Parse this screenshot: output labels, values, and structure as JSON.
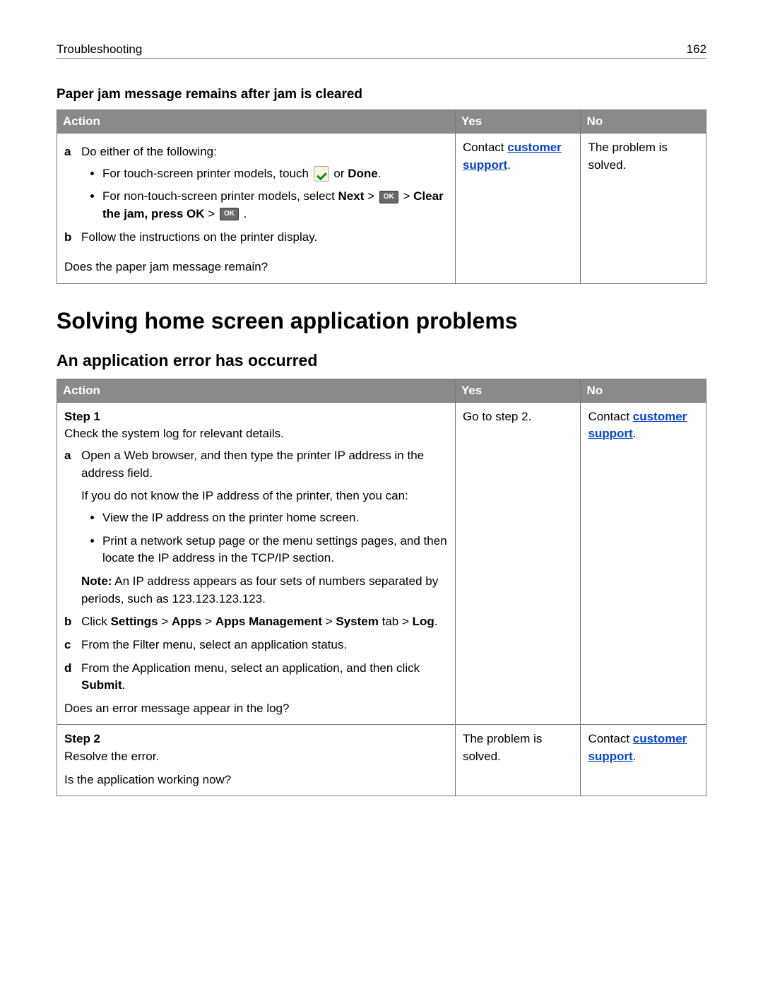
{
  "header": {
    "section": "Troubleshooting",
    "page": "162"
  },
  "section1": {
    "title": "Paper jam message remains after jam is cleared",
    "table": {
      "columns": {
        "action": "Action",
        "yes": "Yes",
        "no": "No"
      },
      "row": {
        "a_intro": "Do either of the following:",
        "bullet1_prefix": "For touch-screen printer models, touch ",
        "bullet1_mid": " or ",
        "bullet1_done": "Done",
        "bullet1_end": ".",
        "bullet2_prefix": "For non-touch-screen printer models, select ",
        "bullet2_next": "Next",
        "bullet2_gt1": " > ",
        "bullet2_gt2": " > ",
        "bullet2_clear": "Clear the jam, press OK",
        "bullet2_gt3": " > ",
        "bullet2_end": " .",
        "b_text": "Follow the instructions on the printer display.",
        "question": "Does the paper jam message remain?",
        "yes_prefix": "Contact ",
        "yes_link": "customer support",
        "yes_suffix": ".",
        "no_text": "The problem is solved."
      }
    }
  },
  "section2": {
    "heading": "Solving home screen application problems",
    "subheading": "An application error has occurred",
    "table": {
      "columns": {
        "action": "Action",
        "yes": "Yes",
        "no": "No"
      },
      "step1": {
        "label": "Step 1",
        "intro": "Check the system log for relevant details.",
        "a_text": "Open a Web browser, and then type the printer IP address in the address field.",
        "a_note1": "If you do not know the IP address of the printer, then you can:",
        "a_bullet1": "View the IP address on the printer home screen.",
        "a_bullet2": "Print a network setup page or the menu settings pages, and then locate the IP address in the TCP/IP section.",
        "a_note_label": "Note:",
        "a_note_text": " An IP address appears as four sets of numbers separated by periods, such as 123.123.123.123.",
        "b_prefix": "Click ",
        "b_settings": "Settings",
        "b_gt1": " > ",
        "b_apps": "Apps",
        "b_gt2": " > ",
        "b_appsmgmt": "Apps Management",
        "b_gt3": " > ",
        "b_system": "System",
        "b_tab": " tab > ",
        "b_log": "Log",
        "b_end": ".",
        "c_text": "From the Filter menu, select an application status.",
        "d_prefix": "From the Application menu, select an application, and then click ",
        "d_submit": "Submit",
        "d_end": ".",
        "question": "Does an error message appear in the log?",
        "yes_text": "Go to step 2.",
        "no_prefix": "Contact ",
        "no_link": "customer support",
        "no_suffix": "."
      },
      "step2": {
        "label": "Step 2",
        "text": "Resolve the error.",
        "question": "Is the application working now?",
        "yes_text": "The problem is solved.",
        "no_prefix": "Contact ",
        "no_link": "customer support",
        "no_suffix": "."
      }
    }
  }
}
